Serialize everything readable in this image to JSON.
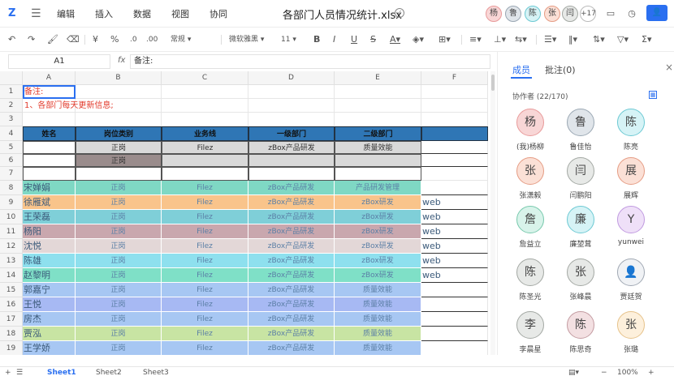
{
  "app": {
    "logo": "Z",
    "title": "各部门人员情况统计.xlsx",
    "menu": [
      "编辑",
      "插入",
      "数据",
      "视图",
      "协同"
    ],
    "collab_extra": "+17"
  },
  "colors": {
    "accent": "#2a6ff0",
    "header_blue": "#2f76b5",
    "red": "#e23a2b",
    "gray_row": "#d9d9d9",
    "dark_gray": "#9a8c8c",
    "teal": "#7fd8c4",
    "orange": "#f9c48b",
    "cyan": "#7fcfd8",
    "rose": "#c9a7ae",
    "light_gray": "#e3d7d7",
    "sky": "#8ee0ee",
    "mint": "#7fe0c7",
    "blue1": "#a7c7f3",
    "blue2": "#a7b9f3",
    "lime": "#c8e4a3"
  },
  "top_avatars": [
    {
      "t": "杨",
      "c": "#f8d6d6",
      "b": "#e89a9a"
    },
    {
      "t": "鲁",
      "c": "#e0e5ea",
      "b": "#9aa7b3"
    },
    {
      "t": "陈",
      "c": "#d6f3f6",
      "b": "#6cc9d3"
    },
    {
      "t": "张",
      "c": "#fbe0d6",
      "b": "#e59c84"
    },
    {
      "t": "闫",
      "c": "#e7e9e7",
      "b": "#a3a8a3"
    }
  ],
  "toolbar": {
    "number_format": "常规",
    "font": "微软雅黑",
    "font_size": "11"
  },
  "formula": {
    "cell_ref": "A1",
    "fx": "fx",
    "value": "备注:"
  },
  "columns": [
    "A",
    "B",
    "C",
    "D",
    "E",
    "F"
  ],
  "rows": [
    {
      "n": "1",
      "cells": [
        "备注:",
        "",
        "",
        "",
        "",
        ""
      ]
    },
    {
      "n": "2",
      "cells": [
        "1、各部门每天更新信息;",
        "",
        "",
        "",
        "",
        ""
      ]
    },
    {
      "n": "3",
      "cells": [
        "",
        "",
        "",
        "",
        "",
        ""
      ]
    },
    {
      "n": "4",
      "cells": [
        "姓名",
        "岗位类别",
        "业务线",
        "一级部门",
        "二级部门",
        ""
      ]
    },
    {
      "n": "5",
      "cells": [
        "",
        "正岗",
        "Filez",
        "zBox产品研发",
        "质量效能",
        ""
      ]
    },
    {
      "n": "6",
      "cells": [
        "",
        "正岗",
        "",
        "",
        "",
        ""
      ]
    },
    {
      "n": "7",
      "cells": [
        "",
        "",
        "",
        "",
        "",
        ""
      ]
    },
    {
      "n": "8",
      "cells": [
        "宋婵娟",
        "正岗",
        "Filez",
        "zBox产品研发",
        "产品研发管理",
        ""
      ]
    },
    {
      "n": "9",
      "cells": [
        "徐雁斌",
        "正岗",
        "Filez",
        "zBox产品研发",
        "zBox研发",
        "web"
      ]
    },
    {
      "n": "10",
      "cells": [
        "王荣磊",
        "正岗",
        "Filez",
        "zBox产品研发",
        "zBox研发",
        "web"
      ]
    },
    {
      "n": "11",
      "cells": [
        "杨阳",
        "正岗",
        "Filez",
        "zBox产品研发",
        "zBox研发",
        "web"
      ]
    },
    {
      "n": "12",
      "cells": [
        "沈悦",
        "正岗",
        "Filez",
        "zBox产品研发",
        "zBox研发",
        "web"
      ]
    },
    {
      "n": "13",
      "cells": [
        "陈雄",
        "正岗",
        "Filez",
        "zBox产品研发",
        "zBox研发",
        "web"
      ]
    },
    {
      "n": "14",
      "cells": [
        "赵黎明",
        "正岗",
        "Filez",
        "zBox产品研发",
        "zBox研发",
        "web"
      ]
    },
    {
      "n": "15",
      "cells": [
        "郭嘉宁",
        "正岗",
        "Filez",
        "zBox产品研发",
        "质量效能",
        ""
      ]
    },
    {
      "n": "16",
      "cells": [
        "王悦",
        "正岗",
        "Filez",
        "zBox产品研发",
        "质量效能",
        ""
      ]
    },
    {
      "n": "17",
      "cells": [
        "房杰",
        "正岗",
        "Filez",
        "zBox产品研发",
        "质量效能",
        ""
      ]
    },
    {
      "n": "18",
      "cells": [
        "贾泓",
        "正岗",
        "Filez",
        "zBox产品研发",
        "质量效能",
        ""
      ]
    },
    {
      "n": "19",
      "cells": [
        "王学娇",
        "正岗",
        "Filez",
        "zBox产品研发",
        "质量效能",
        ""
      ]
    }
  ],
  "sidebar": {
    "tab_members": "成员",
    "tab_comments": "批注(0)",
    "collab_label": "协作者 (22/170)",
    "members": [
      {
        "t": "杨",
        "n": "(我)杨柳",
        "c": "#f8d6d6",
        "b": "#e89a9a"
      },
      {
        "t": "鲁",
        "n": "鲁佳怡",
        "c": "#e0e5ea",
        "b": "#9aa7b3"
      },
      {
        "t": "陈",
        "n": "陈亮",
        "c": "#d6f3f6",
        "b": "#6cc9d3"
      },
      {
        "t": "张",
        "n": "张潇毅",
        "c": "#fbe0d6",
        "b": "#e59c84"
      },
      {
        "t": "闫",
        "n": "闫鹏阳",
        "c": "#e7e9e7",
        "b": "#a3a8a3"
      },
      {
        "t": "展",
        "n": "展辉",
        "c": "#fbe0d6",
        "b": "#e59c84"
      },
      {
        "t": "詹",
        "n": "詹益立",
        "c": "#d8f3ea",
        "b": "#78c9ad"
      },
      {
        "t": "廉",
        "n": "廉堃茸",
        "c": "#d6f3f6",
        "b": "#6cc9d3"
      },
      {
        "t": "Y",
        "n": "yunwei",
        "c": "#efe0f8",
        "b": "#c09ae0"
      },
      {
        "t": "陈",
        "n": "陈圣光",
        "c": "#e7e9e7",
        "b": "#a3a8a3"
      },
      {
        "t": "张",
        "n": "张峰晨",
        "c": "#e7e9e7",
        "b": "#a3a8a3"
      },
      {
        "t": "",
        "n": "贾廷贺",
        "c": "#f0f2f5",
        "b": "#a0a8b3"
      },
      {
        "t": "李",
        "n": "李晨星",
        "c": "#e7e9e7",
        "b": "#a3a8a3"
      },
      {
        "t": "陈",
        "n": "陈思奇",
        "c": "#f3e0e2",
        "b": "#c39ba1"
      },
      {
        "t": "张",
        "n": "张璐",
        "c": "#fdf0dc",
        "b": "#e6c28a"
      }
    ]
  },
  "sheets": [
    "Sheet1",
    "Sheet2",
    "Sheet3"
  ],
  "zoom": "100%"
}
